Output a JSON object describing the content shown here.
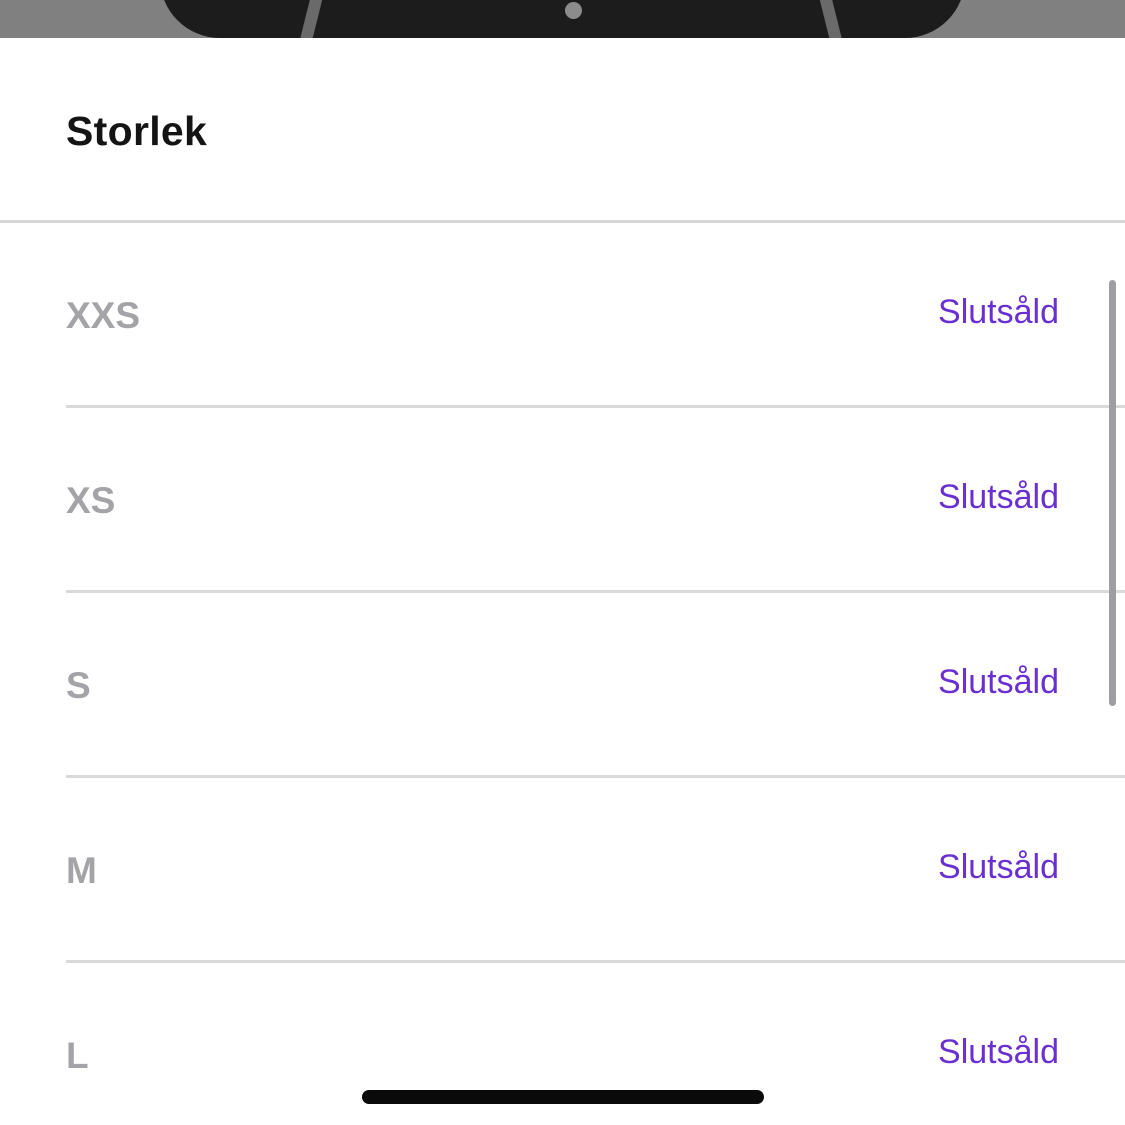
{
  "sheet": {
    "title": "Storlek"
  },
  "sizes": [
    {
      "label": "XXS",
      "status": "Slutsåld"
    },
    {
      "label": "XS",
      "status": "Slutsåld"
    },
    {
      "label": "S",
      "status": "Slutsåld"
    },
    {
      "label": "M",
      "status": "Slutsåld"
    },
    {
      "label": "L",
      "status": "Slutsåld"
    }
  ],
  "colors": {
    "accent": "#6a2fd1",
    "disabled_text": "#a4a4a8",
    "title_text": "#141414"
  }
}
